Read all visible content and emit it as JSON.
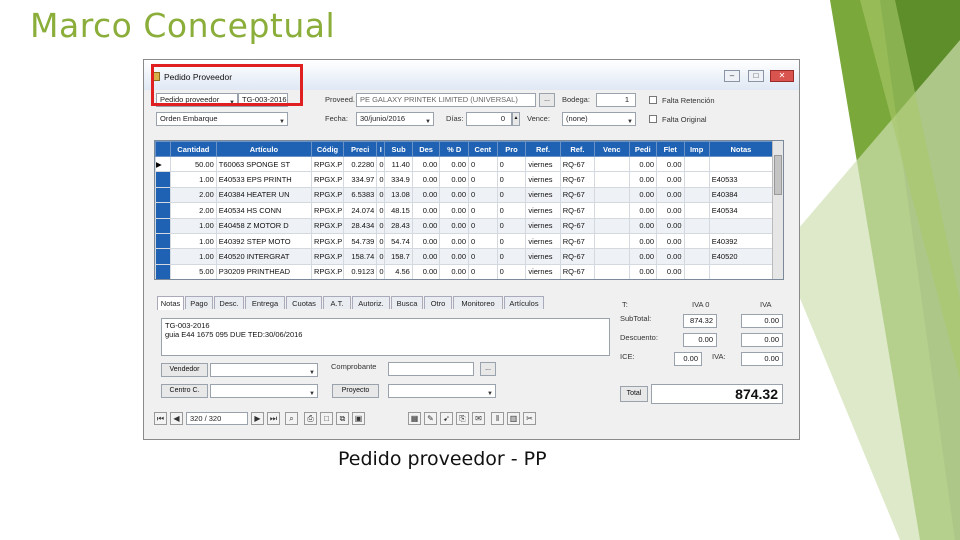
{
  "slide": {
    "title": "Marco Conceptual",
    "caption": "Pedido proveedor - PP"
  },
  "window": {
    "title": "Pedido Proveedor",
    "controls": {
      "minimize": "–",
      "maximize": "□",
      "close": "✕"
    }
  },
  "header": {
    "doc_type": "Pedido proveedor",
    "doc_number": "TG-003-2016",
    "order_type": "Orden Embarque",
    "proveedor_label": "Proveed.",
    "proveedor_value": "PE GALAXY PRINTEK LIMITED (UNIVERSAL)",
    "proveedor_btn": "...",
    "bodega_label": "Bodega:",
    "bodega_value": "1",
    "fecha_label": "Fecha:",
    "fecha_value": "30/junio/2016",
    "dias_label": "Días:",
    "dias_value": "0",
    "vence_label": "Vence:",
    "vence_value": "(none)",
    "falta_retencion": "Falta Retención",
    "falta_original": "Falta Original"
  },
  "grid": {
    "columns": [
      "Cantidad",
      "Artículo",
      "Códig",
      "Preci",
      "I",
      "Sub",
      "Des",
      "% D",
      "Cent",
      "Pro",
      "Ref.",
      "Ref.",
      "Venc",
      "Pedi",
      "Flet",
      "Imp",
      "Notas"
    ],
    "rows": [
      [
        "50.00",
        "T60063 SPONGE ST",
        "RPGX.P",
        "0.2280",
        "0",
        "11.40",
        "0.00",
        "0.00",
        "0",
        "0",
        "viernes",
        "RQ-67",
        "",
        "0.00",
        "0.00",
        "",
        ""
      ],
      [
        "1.00",
        "E40533 EPS PRINTH",
        "RPGX.P",
        "334.97",
        "0",
        "334.9",
        "0.00",
        "0.00",
        "0",
        "0",
        "viernes",
        "RQ-67",
        "",
        "0.00",
        "0.00",
        "",
        "E40533"
      ],
      [
        "2.00",
        "E40384 HEATER UN",
        "RPGX.P",
        "6.5383",
        "0",
        "13.08",
        "0.00",
        "0.00",
        "0",
        "0",
        "viernes",
        "RQ-67",
        "",
        "0.00",
        "0.00",
        "",
        "E40384"
      ],
      [
        "2.00",
        "E40534 HS CONN",
        "RPGX.P",
        "24.074",
        "0",
        "48.15",
        "0.00",
        "0.00",
        "0",
        "0",
        "viernes",
        "RQ-67",
        "",
        "0.00",
        "0.00",
        "",
        "E40534"
      ],
      [
        "1.00",
        "E40458 Z MOTOR D",
        "RPGX.P",
        "28.434",
        "0",
        "28.43",
        "0.00",
        "0.00",
        "0",
        "0",
        "viernes",
        "RQ-67",
        "",
        "0.00",
        "0.00",
        "",
        ""
      ],
      [
        "1.00",
        "E40392 STEP MOTO",
        "RPGX.P",
        "54.739",
        "0",
        "54.74",
        "0.00",
        "0.00",
        "0",
        "0",
        "viernes",
        "RQ-67",
        "",
        "0.00",
        "0.00",
        "",
        "E40392"
      ],
      [
        "1.00",
        "E40520 INTERGRAT",
        "RPGX.P",
        "158.74",
        "0",
        "158.7",
        "0.00",
        "0.00",
        "0",
        "0",
        "viernes",
        "RQ-67",
        "",
        "0.00",
        "0.00",
        "",
        "E40520"
      ],
      [
        "5.00",
        "P30209 PRINTHEAD",
        "RPGX.P",
        "0.9123",
        "0",
        "4.56",
        "0.00",
        "0.00",
        "0",
        "0",
        "viernes",
        "RQ-67",
        "",
        "0.00",
        "0.00",
        "",
        ""
      ]
    ]
  },
  "tabs": [
    "Notas",
    "Pago",
    "Desc.",
    "Entrega",
    "Cuotas",
    "A.T.",
    "Autoriz.",
    "Busca",
    "Otro",
    "Monitoreo",
    "Artículos"
  ],
  "notes": {
    "line1": "TG-003-2016",
    "line2": "guia E44 1675 095 DUE TED:30/06/2016"
  },
  "lower": {
    "vendedor": "Vendedor",
    "centro": "Centro C.",
    "comprobante": "Comprobante",
    "proyecto": "Proyecto",
    "dots": "..."
  },
  "totals": {
    "t_label": "T:",
    "iva0_label": "IVA 0",
    "iva_label": "IVA",
    "subtotal_label": "SubTotal:",
    "subtotal_iva0": "874.32",
    "subtotal_iva": "0.00",
    "descuento_label": "Descuento:",
    "descuento_iva0": "0.00",
    "descuento_iva": "0.00",
    "ice_label": "ICE:",
    "ice_iva0": "0.00",
    "iva_row_label": "IVA:",
    "iva_row_value": "0.00",
    "total_btn": "Total",
    "total_value": "874.32"
  },
  "navigator": {
    "position": "320 / 320"
  }
}
